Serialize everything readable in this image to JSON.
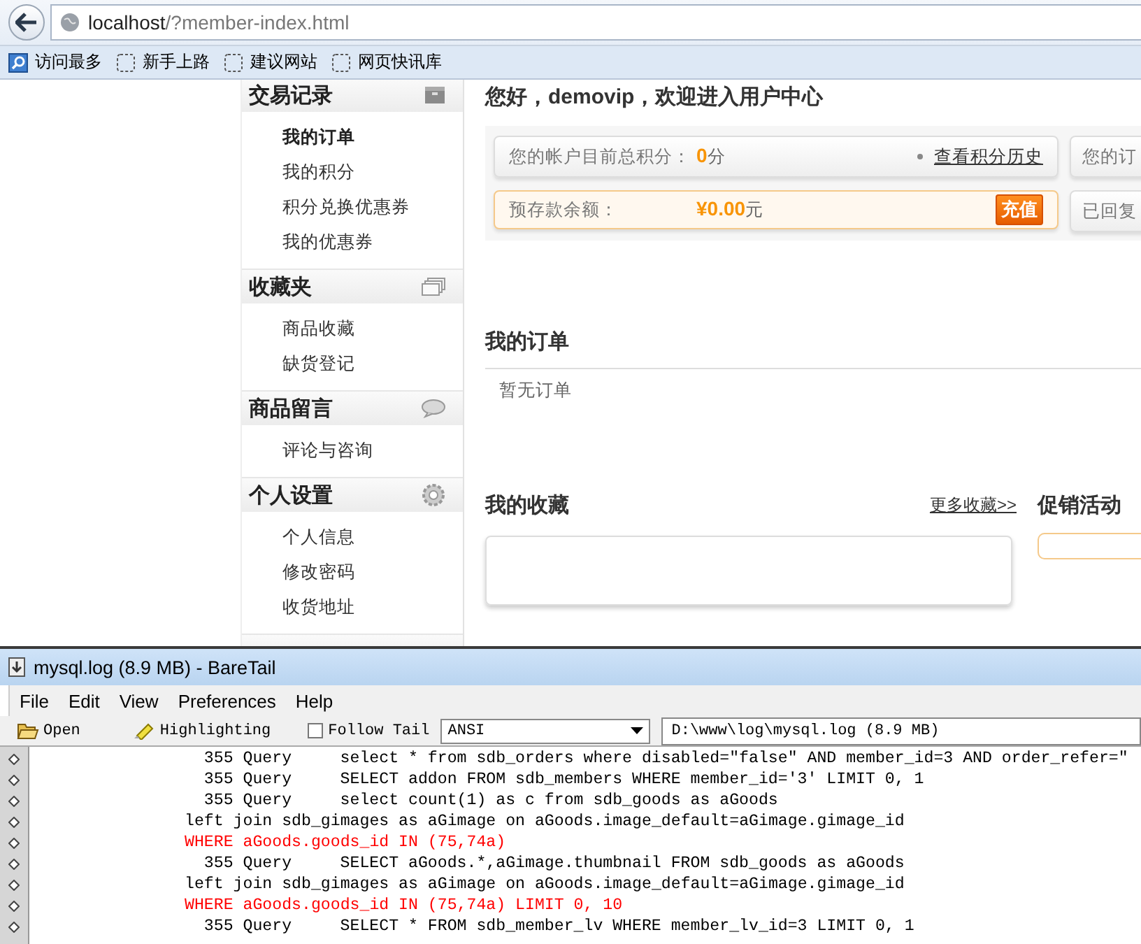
{
  "browser": {
    "address": {
      "host": "localhost",
      "path": "/?member-index.html"
    },
    "bookmarks": [
      {
        "label": "访问最多"
      },
      {
        "label": "新手上路"
      },
      {
        "label": "建议网站"
      },
      {
        "label": "网页快讯库"
      }
    ]
  },
  "sidebar": {
    "sections": [
      {
        "title": "交易记录",
        "items": [
          {
            "label": "我的订单",
            "selected": true
          },
          {
            "label": "我的积分",
            "selected": false
          },
          {
            "label": "积分兑换优惠券",
            "selected": false
          },
          {
            "label": "我的优惠券",
            "selected": false
          }
        ]
      },
      {
        "title": "收藏夹",
        "items": [
          {
            "label": "商品收藏",
            "selected": false
          },
          {
            "label": "缺货登记",
            "selected": false
          }
        ]
      },
      {
        "title": "商品留言",
        "items": [
          {
            "label": "评论与咨询",
            "selected": false
          }
        ]
      },
      {
        "title": "个人设置",
        "items": [
          {
            "label": "个人信息",
            "selected": false
          },
          {
            "label": "修改密码",
            "selected": false
          },
          {
            "label": "收货地址",
            "selected": false
          }
        ]
      }
    ]
  },
  "main": {
    "greeting": "您好，demovip，欢迎进入用户中心",
    "points": {
      "label": "您的帐户目前总积分：",
      "value": "0",
      "unit": "分",
      "link": "查看积分历史"
    },
    "orders_box": "您的订",
    "balance": {
      "label": "预存款余额：",
      "value": "¥0.00",
      "unit": "元",
      "button": "充值"
    },
    "replies_box": "已回复",
    "orders": {
      "title": "我的订单",
      "empty": "暂无订单"
    },
    "favorites": {
      "title": "我的收藏",
      "more": "更多收藏>>"
    },
    "promotions": {
      "title": "促销活动"
    }
  },
  "baretail": {
    "title": "mysql.log (8.9 MB) - BareTail",
    "menu": [
      "File",
      "Edit",
      "View",
      "Preferences",
      "Help"
    ],
    "toolbar": {
      "open": "Open",
      "highlighting": "Highlighting",
      "follow_tail": {
        "label": "Follow Tail",
        "checked": false
      },
      "encoding": "ANSI",
      "path": "D:\\www\\log\\mysql.log (8.9 MB)"
    },
    "log": [
      {
        "kind": "query",
        "thread": "355",
        "command": "Query",
        "text": "select * from sdb_orders where disabled=\"false\" AND member_id=3 AND order_refer=\"",
        "highlighted": false
      },
      {
        "kind": "query",
        "thread": "355",
        "command": "Query",
        "text": "SELECT addon FROM sdb_members WHERE member_id='3' LIMIT 0, 1",
        "highlighted": false
      },
      {
        "kind": "query",
        "thread": "355",
        "command": "Query",
        "text": "select count(1) as c from sdb_goods as aGoods",
        "highlighted": false
      },
      {
        "kind": "continuation",
        "text": "left join sdb_gimages as aGimage on aGoods.image_default=aGimage.gimage_id",
        "highlighted": false
      },
      {
        "kind": "continuation",
        "text": "WHERE aGoods.goods_id IN (75,74a)",
        "highlighted": true
      },
      {
        "kind": "query",
        "thread": "355",
        "command": "Query",
        "text": "SELECT aGoods.*,aGimage.thumbnail FROM sdb_goods as aGoods",
        "highlighted": false
      },
      {
        "kind": "continuation",
        "text": "left join sdb_gimages as aGimage on aGoods.image_default=aGimage.gimage_id",
        "highlighted": false
      },
      {
        "kind": "continuation",
        "text": "WHERE aGoods.goods_id IN (75,74a) LIMIT 0, 10",
        "highlighted": true
      },
      {
        "kind": "query",
        "thread": "355",
        "command": "Query",
        "text": "SELECT * FROM sdb_member_lv WHERE member_lv_id=3 LIMIT 0, 1",
        "highlighted": false
      }
    ]
  }
}
